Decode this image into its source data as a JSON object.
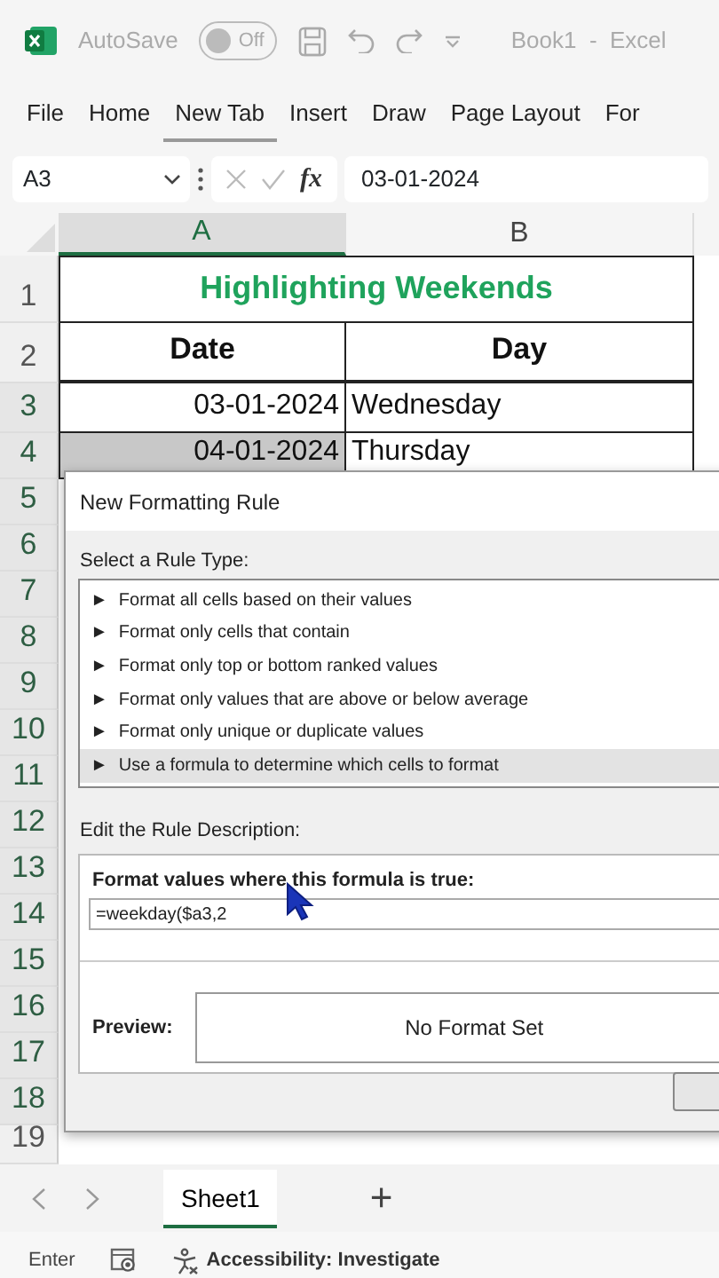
{
  "title_bar": {
    "autosave_label": "AutoSave",
    "autosave_toggle": {
      "label": "Off",
      "on": false
    },
    "document_title": "Book1  -  Excel"
  },
  "ribbon_tabs": [
    {
      "label": "File",
      "selected": false
    },
    {
      "label": "Home",
      "selected": false
    },
    {
      "label": "New Tab",
      "selected": true
    },
    {
      "label": "Insert",
      "selected": false
    },
    {
      "label": "Draw",
      "selected": false
    },
    {
      "label": "Page Layout",
      "selected": false
    },
    {
      "label": "For",
      "selected": false
    }
  ],
  "formula_bar": {
    "name_box": "A3",
    "function_label": "fx",
    "value": "03-01-2024"
  },
  "columns": [
    {
      "label": "A",
      "selected": true
    },
    {
      "label": "B",
      "selected": false
    }
  ],
  "rows": [
    {
      "number": "1",
      "selected": false,
      "kind": "title",
      "cells": [
        {
          "text": "Highlighting Weekends",
          "highlighted": false
        }
      ]
    },
    {
      "number": "2",
      "selected": false,
      "kind": "header",
      "cells": [
        {
          "text": "Date",
          "highlighted": false
        },
        {
          "text": "Day",
          "highlighted": false
        }
      ]
    },
    {
      "number": "3",
      "selected": true,
      "kind": "data",
      "cells": [
        {
          "text": "03-01-2024",
          "highlighted": false
        },
        {
          "text": "Wednesday",
          "highlighted": false
        }
      ]
    },
    {
      "number": "4",
      "selected": true,
      "kind": "data",
      "cells": [
        {
          "text": "04-01-2024",
          "highlighted": true
        },
        {
          "text": "Thursday",
          "highlighted": false
        }
      ]
    },
    {
      "number": "5",
      "selected": true,
      "kind": "hidden"
    },
    {
      "number": "6",
      "selected": true,
      "kind": "hidden"
    },
    {
      "number": "7",
      "selected": true,
      "kind": "hidden"
    },
    {
      "number": "8",
      "selected": true,
      "kind": "hidden"
    },
    {
      "number": "9",
      "selected": true,
      "kind": "hidden"
    },
    {
      "number": "10",
      "selected": true,
      "kind": "hidden"
    },
    {
      "number": "11",
      "selected": true,
      "kind": "hidden"
    },
    {
      "number": "12",
      "selected": true,
      "kind": "hidden"
    },
    {
      "number": "13",
      "selected": true,
      "kind": "hidden"
    },
    {
      "number": "14",
      "selected": true,
      "kind": "hidden"
    },
    {
      "number": "15",
      "selected": true,
      "kind": "hidden"
    },
    {
      "number": "16",
      "selected": true,
      "kind": "hidden"
    },
    {
      "number": "17",
      "selected": true,
      "kind": "hidden"
    },
    {
      "number": "18",
      "selected": true,
      "kind": "hidden"
    },
    {
      "number": "19",
      "selected": false,
      "kind": "empty"
    }
  ],
  "dialog": {
    "title": "New Formatting Rule",
    "rule_type_label": "Select a Rule Type:",
    "rule_types": [
      {
        "label": "Format all cells based on their values",
        "selected": false
      },
      {
        "label": "Format only cells that contain",
        "selected": false
      },
      {
        "label": "Format only top or bottom ranked values",
        "selected": false
      },
      {
        "label": "Format only values that are above or below average",
        "selected": false
      },
      {
        "label": "Format only unique or duplicate values",
        "selected": false
      },
      {
        "label": "Use a formula to determine which cells to format",
        "selected": true
      }
    ],
    "bullet": "►",
    "description_label": "Edit the Rule Description:",
    "formula_label": "Format values where this formula is true:",
    "formula_value": "=weekday($a3,2",
    "preview_label": "Preview:",
    "preview_text": "No Format Set"
  },
  "sheet_tabs": [
    {
      "label": "Sheet1",
      "selected": true
    }
  ],
  "add_sheet": "+",
  "status_bar": {
    "mode": "Enter",
    "accessibility": "Accessibility: Investigate"
  }
}
